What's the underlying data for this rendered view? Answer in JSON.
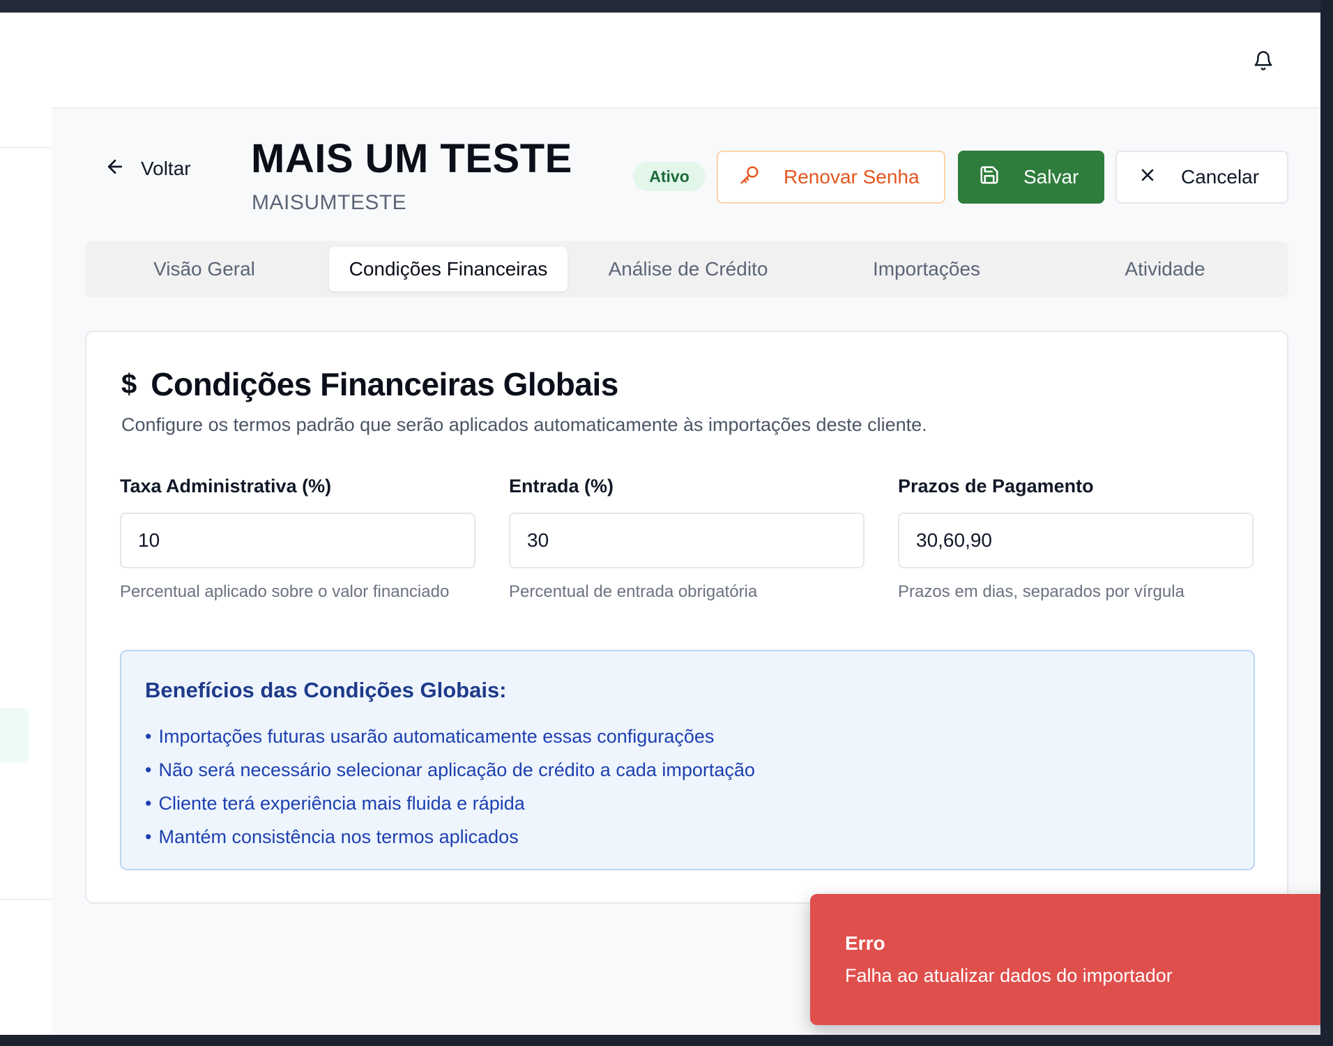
{
  "header": {
    "back_label": "Voltar",
    "title": "MAIS UM TESTE",
    "subtitle": "MAISUMTESTE",
    "status_badge": "Ativo",
    "renew_password_label": "Renovar Senha",
    "save_label": "Salvar",
    "cancel_label": "Cancelar"
  },
  "tabs": [
    {
      "label": "Visão Geral",
      "active": false
    },
    {
      "label": "Condições Financeiras",
      "active": true
    },
    {
      "label": "Análise de Crédito",
      "active": false
    },
    {
      "label": "Importações",
      "active": false
    },
    {
      "label": "Atividade",
      "active": false
    }
  ],
  "card": {
    "title": "Condições Financeiras Globais",
    "description": "Configure os termos padrão que serão aplicados automaticamente às importações deste cliente.",
    "fields": [
      {
        "label": "Taxa Administrativa (%)",
        "value": "10",
        "hint": "Percentual aplicado sobre o valor financiado"
      },
      {
        "label": "Entrada (%)",
        "value": "30",
        "hint": "Percentual de entrada obrigatória"
      },
      {
        "label": "Prazos de Pagamento",
        "value": "30,60,90",
        "hint": "Prazos em dias, separados por vírgula"
      }
    ],
    "benefits": {
      "title": "Benefícios das Condições Globais:",
      "items": [
        "Importações futuras usarão automaticamente essas configurações",
        "Não será necessário selecionar aplicação de crédito a cada importação",
        "Cliente terá experiência mais fluida e rápida",
        "Mantém consistência nos termos aplicados"
      ]
    }
  },
  "toast": {
    "title": "Erro",
    "message": "Falha ao atualizar dados do importador"
  },
  "colors": {
    "save_button": "#2f7d3c",
    "renew_button_text": "#e4561f",
    "toast_background": "#df4f4c",
    "benefits_background": "#eef5fd",
    "badge_background": "#e3f6ea"
  },
  "icons": {
    "bell": "bell-icon",
    "back": "arrow-left-icon",
    "renew": "key-icon",
    "save": "floppy-disk-icon",
    "cancel": "close-icon",
    "card_title": "dollar-icon"
  }
}
